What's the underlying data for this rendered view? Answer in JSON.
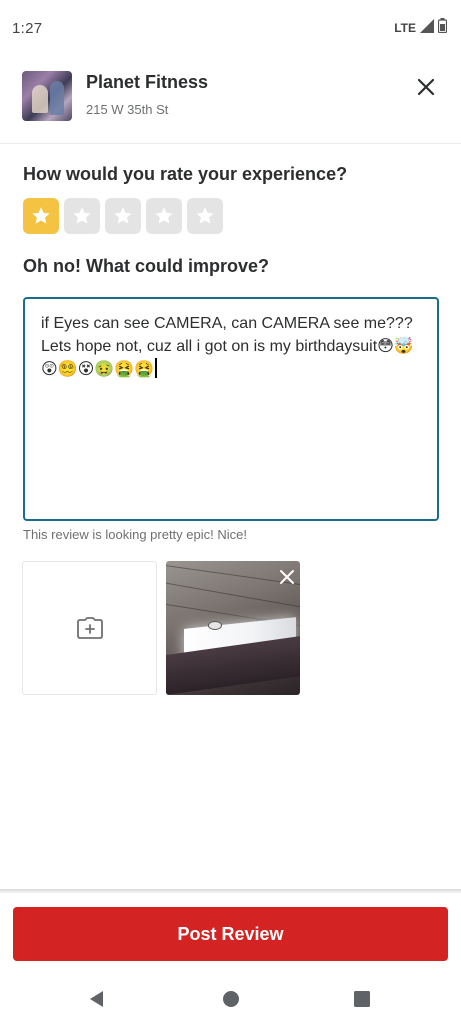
{
  "status_bar": {
    "time": "1:27",
    "network": "LTE",
    "icons": [
      "signal-icon",
      "battery-icon"
    ]
  },
  "business": {
    "name": "Planet Fitness",
    "address": "215 W 35th St",
    "close_icon": "close-icon"
  },
  "rating": {
    "question": "How would you rate your experience?",
    "selected": 1,
    "max": 5,
    "active_color": "#f5c342",
    "inactive_color": "#e4e4e4"
  },
  "review": {
    "prompt": "Oh no! What could improve?",
    "text": "if Eyes can see CAMERA, can CAMERA see me??? Lets hope not, cuz all i got on is my birthdaysuit😳🤯😲😵‍💫😵🤢🤮🤮",
    "hint": "This review is looking pretty epic! Nice!",
    "border_color": "#1a6d8a"
  },
  "photos": {
    "add_icon": "camera-plus-icon",
    "remove_icon": "close-icon"
  },
  "footer": {
    "post_label": "Post Review",
    "button_color": "#d32323"
  },
  "nav": {
    "icons": [
      "back-icon",
      "home-icon",
      "recents-icon"
    ]
  }
}
